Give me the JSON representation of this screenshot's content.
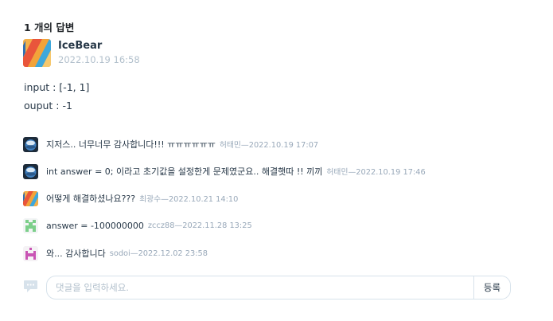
{
  "answers_header": "1 개의 답변",
  "answer": {
    "author": "IceBear",
    "date": "2022.10.19 16:58",
    "body_lines": [
      "input : [-1, 1]",
      "ouput : -1"
    ]
  },
  "comments": [
    {
      "text": "지저스.. 너무너무 감사합니다!!! ㅠㅠㅠㅠㅠㅠ",
      "author": "허태민",
      "date": "2022.10.19 17:07",
      "avatar_icon": "planet-avatar-icon"
    },
    {
      "text": "int answer = 0; 이라고 초기값을 설정한게 문제였군요.. 해결햇따 !! 끼끼",
      "author": "허태민",
      "date": "2022.10.19 17:46",
      "avatar_icon": "planet-avatar-icon"
    },
    {
      "text": "어떻게 해결하셨나요???",
      "author": "최광수",
      "date": "2022.10.21 14:10",
      "avatar_icon": "stripes-avatar-icon"
    },
    {
      "text": "answer = -100000000",
      "author": "zccz88",
      "date": "2022.11.28 13:25",
      "avatar_icon": "green-pixel-avatar-icon"
    },
    {
      "text": "와... 감사합니다",
      "author": "sodoi",
      "date": "2022.12.02 23:58",
      "avatar_icon": "pink-pixel-avatar-icon"
    }
  ],
  "reply": {
    "placeholder": "댓글을 입력하세요.",
    "submit_label": "등록",
    "icon": "comment-bubble-icon"
  },
  "colors": {
    "text": "#263747",
    "meta": "#98a8b9",
    "border": "#d7e2eb"
  }
}
